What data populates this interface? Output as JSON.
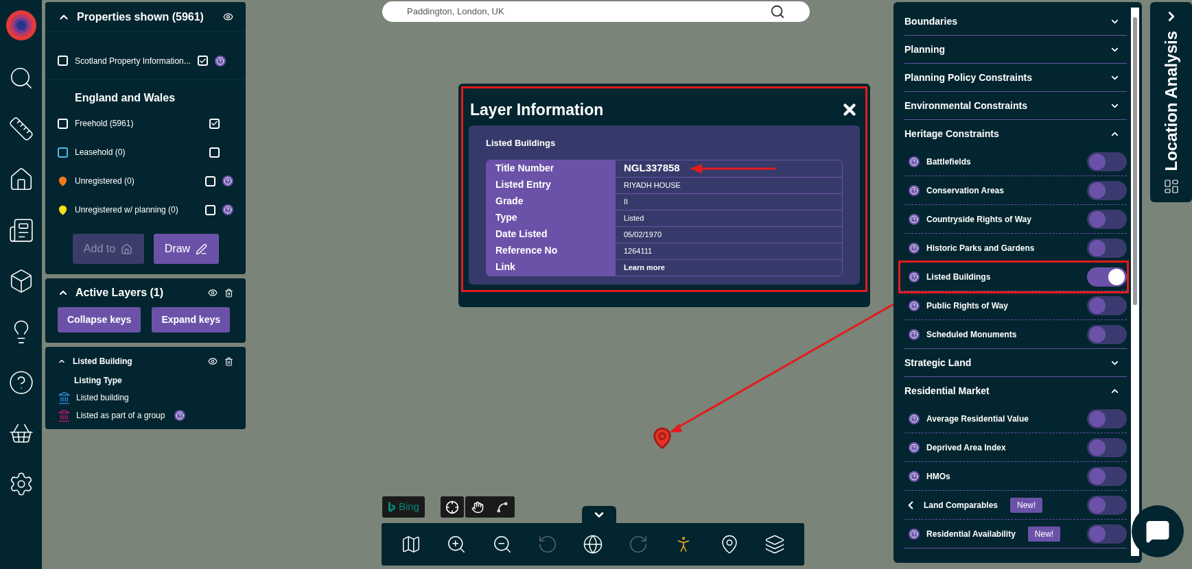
{
  "search": {
    "value": "Paddington, London, UK"
  },
  "properties": {
    "title": "Properties shown (5961)",
    "expanded": true,
    "scotland": {
      "label": "Scotland Property Information...",
      "checked": true,
      "help": true
    },
    "section_title": "England and Wales",
    "rows": [
      {
        "label": "Freehold (5961)",
        "kind": "box",
        "color": "#ffffff",
        "checked": true,
        "help": false
      },
      {
        "label": "Leasehold (0)",
        "kind": "box",
        "color": "#4fb8e8",
        "checked": false,
        "help": false
      },
      {
        "label": "Unregistered (0)",
        "kind": "pin",
        "color": "#f07a1a",
        "checked": false,
        "help": true
      },
      {
        "label": "Unregistered w/ planning (0)",
        "kind": "pin",
        "color": "#f5e21a",
        "checked": false,
        "help": true
      }
    ],
    "buttons": [
      {
        "label": "Add to",
        "kind": "add",
        "disabled": true
      },
      {
        "label": "Draw",
        "kind": "draw",
        "disabled": false
      }
    ]
  },
  "active_layers": {
    "title": "Active Layers (1)",
    "expanded": true,
    "buttons": [
      "Collapse keys",
      "Expand keys"
    ]
  },
  "legend": {
    "title": "Listed Building",
    "expanded": true,
    "subtitle": "Listing Type",
    "items": [
      {
        "label": "Listed building",
        "color": "#2a83d0",
        "help": false
      },
      {
        "label": "Listed as part of a group",
        "color": "#b4176f",
        "help": true
      }
    ]
  },
  "layer_info": {
    "title": "Layer Information",
    "highlighted": true,
    "subtitle": "Listed Buildings",
    "rows": [
      {
        "label": "Title Number",
        "value": "NGL337858",
        "kind": "emphasis",
        "arrow": true
      },
      {
        "label": "Listed Entry",
        "value": "RIYADH HOUSE",
        "kind": "text",
        "arrow": false
      },
      {
        "label": "Grade",
        "value": "II",
        "kind": "text",
        "arrow": false
      },
      {
        "label": "Type",
        "value": "Listed",
        "kind": "text",
        "arrow": false
      },
      {
        "label": "Date Listed",
        "value": "05/02/1970",
        "kind": "text",
        "arrow": false
      },
      {
        "label": "Reference No",
        "value": "1264111",
        "kind": "text",
        "arrow": false
      },
      {
        "label": "Link",
        "value": "Learn more",
        "kind": "link",
        "arrow": false
      }
    ]
  },
  "layers_panel": {
    "groups": [
      {
        "title": "Boundaries",
        "expanded": false
      },
      {
        "title": "Planning",
        "expanded": false
      },
      {
        "title": "Planning Policy Constraints",
        "expanded": false
      },
      {
        "title": "Environmental Constraints",
        "expanded": false
      },
      {
        "title": "Heritage Constraints",
        "expanded": true,
        "items": [
          {
            "label": "Battlefields",
            "kind": "help",
            "on": false,
            "highlighted": false
          },
          {
            "label": "Conservation Areas",
            "kind": "help",
            "on": false,
            "highlighted": false
          },
          {
            "label": "Countryside Rights of Way",
            "kind": "help",
            "on": false,
            "highlighted": false
          },
          {
            "label": "Historic Parks and Gardens",
            "kind": "help",
            "on": false,
            "highlighted": false
          },
          {
            "label": "Listed Buildings",
            "kind": "help",
            "on": true,
            "highlighted": true
          },
          {
            "label": "Public Rights of Way",
            "kind": "help",
            "on": false,
            "highlighted": false
          },
          {
            "label": "Scheduled Monuments",
            "kind": "help",
            "on": false,
            "highlighted": false
          }
        ]
      },
      {
        "title": "Strategic Land",
        "expanded": false
      },
      {
        "title": "Residential Market",
        "expanded": true,
        "items": [
          {
            "label": "Average Residential Value",
            "kind": "help",
            "on": false,
            "highlighted": false
          },
          {
            "label": "Deprived Area Index",
            "kind": "help",
            "on": false,
            "highlighted": false
          },
          {
            "label": "HMOs",
            "kind": "help",
            "on": false,
            "highlighted": false
          },
          {
            "label": "Land Comparables",
            "kind": "submenu",
            "badge": "New!",
            "on": false,
            "highlighted": false
          },
          {
            "label": "Residential Availability",
            "kind": "help",
            "badge": "New!",
            "on": false,
            "highlighted": false
          }
        ]
      }
    ]
  },
  "side_tab": {
    "title": "Location Analysis"
  },
  "map": {
    "provider": "Bing"
  },
  "toolbar": {
    "tools": [
      {
        "kind": "map",
        "disabled": false
      },
      {
        "kind": "zoom-in",
        "disabled": false
      },
      {
        "kind": "zoom-out",
        "disabled": false
      },
      {
        "kind": "rotate-left",
        "disabled": true
      },
      {
        "kind": "globe",
        "disabled": false
      },
      {
        "kind": "rotate-right",
        "disabled": true
      },
      {
        "kind": "person",
        "disabled": false
      },
      {
        "kind": "pin",
        "disabled": false
      },
      {
        "kind": "layers",
        "disabled": false
      }
    ]
  }
}
